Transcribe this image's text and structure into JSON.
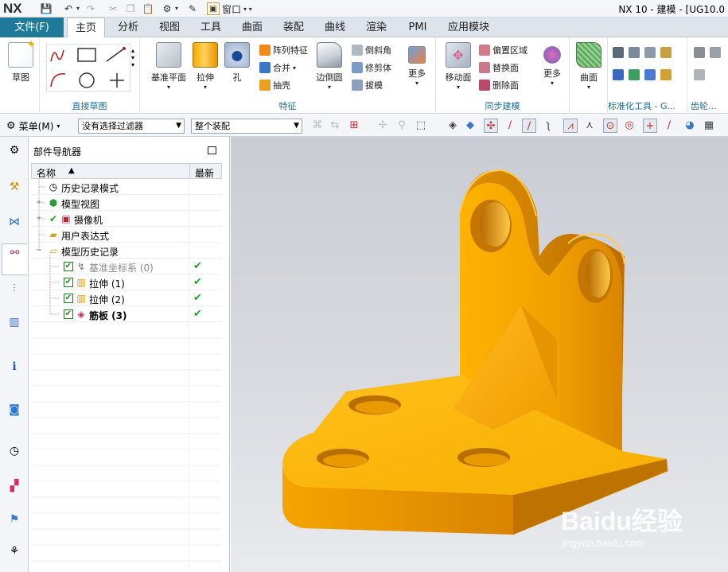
{
  "app": {
    "logo": "NX",
    "title": "NX 10 - 建模 - [UG10.0",
    "window_menu": "窗口"
  },
  "tabs": {
    "file": "文件(F)",
    "items": [
      "主页",
      "分析",
      "视图",
      "工具",
      "曲面",
      "装配",
      "曲线",
      "渲染",
      "PMI",
      "应用模块"
    ],
    "active": "主页"
  },
  "ribbon": {
    "sketch": {
      "label": "草图"
    },
    "direct_sketch": {
      "group": "直接草图"
    },
    "features": {
      "group": "特征",
      "datum_plane": "基准平面",
      "extrude": "拉伸",
      "hole": "孔",
      "pattern_feature": "阵列特征",
      "unite": "合并",
      "shell": "抽壳",
      "edge_blend": "边倒圆",
      "chamfer": "倒斜角",
      "trim_body": "修剪体",
      "draft": "拔模",
      "more": "更多"
    },
    "sync": {
      "group": "同步建模",
      "move_face": "移动面",
      "offset_region": "偏置区域",
      "replace_face": "替换面",
      "delete_face": "删除面",
      "more": "更多"
    },
    "surface": {
      "label": "曲面"
    },
    "standard_tools": {
      "group": "标准化工具 - G..."
    },
    "gear": {
      "group": "齿轮..."
    }
  },
  "toolbar2": {
    "menu": "菜单(M)",
    "filter": "没有选择过滤器",
    "scope": "整个装配"
  },
  "navigator": {
    "title": "部件导航器",
    "col_name": "名称",
    "col_latest": "最新",
    "rows": [
      {
        "label": "历史记录模式",
        "latest": ""
      },
      {
        "label": "模型视图",
        "latest": ""
      },
      {
        "label": "摄像机",
        "latest": ""
      },
      {
        "label": "用户表达式",
        "latest": ""
      },
      {
        "label": "模型历史记录",
        "latest": ""
      },
      {
        "label": "基准坐标系 (0)",
        "latest": "✔"
      },
      {
        "label": "拉伸 (1)",
        "latest": "✔"
      },
      {
        "label": "拉伸 (2)",
        "latest": "✔"
      },
      {
        "label": "筋板 (3)",
        "latest": "✔"
      }
    ]
  },
  "watermark": {
    "brand": "Baidu经验",
    "url": "jingyan.baidu.com"
  },
  "colors": {
    "accent": "#1f7a9a",
    "model": "#f5a800",
    "check": "#1ea31e"
  }
}
